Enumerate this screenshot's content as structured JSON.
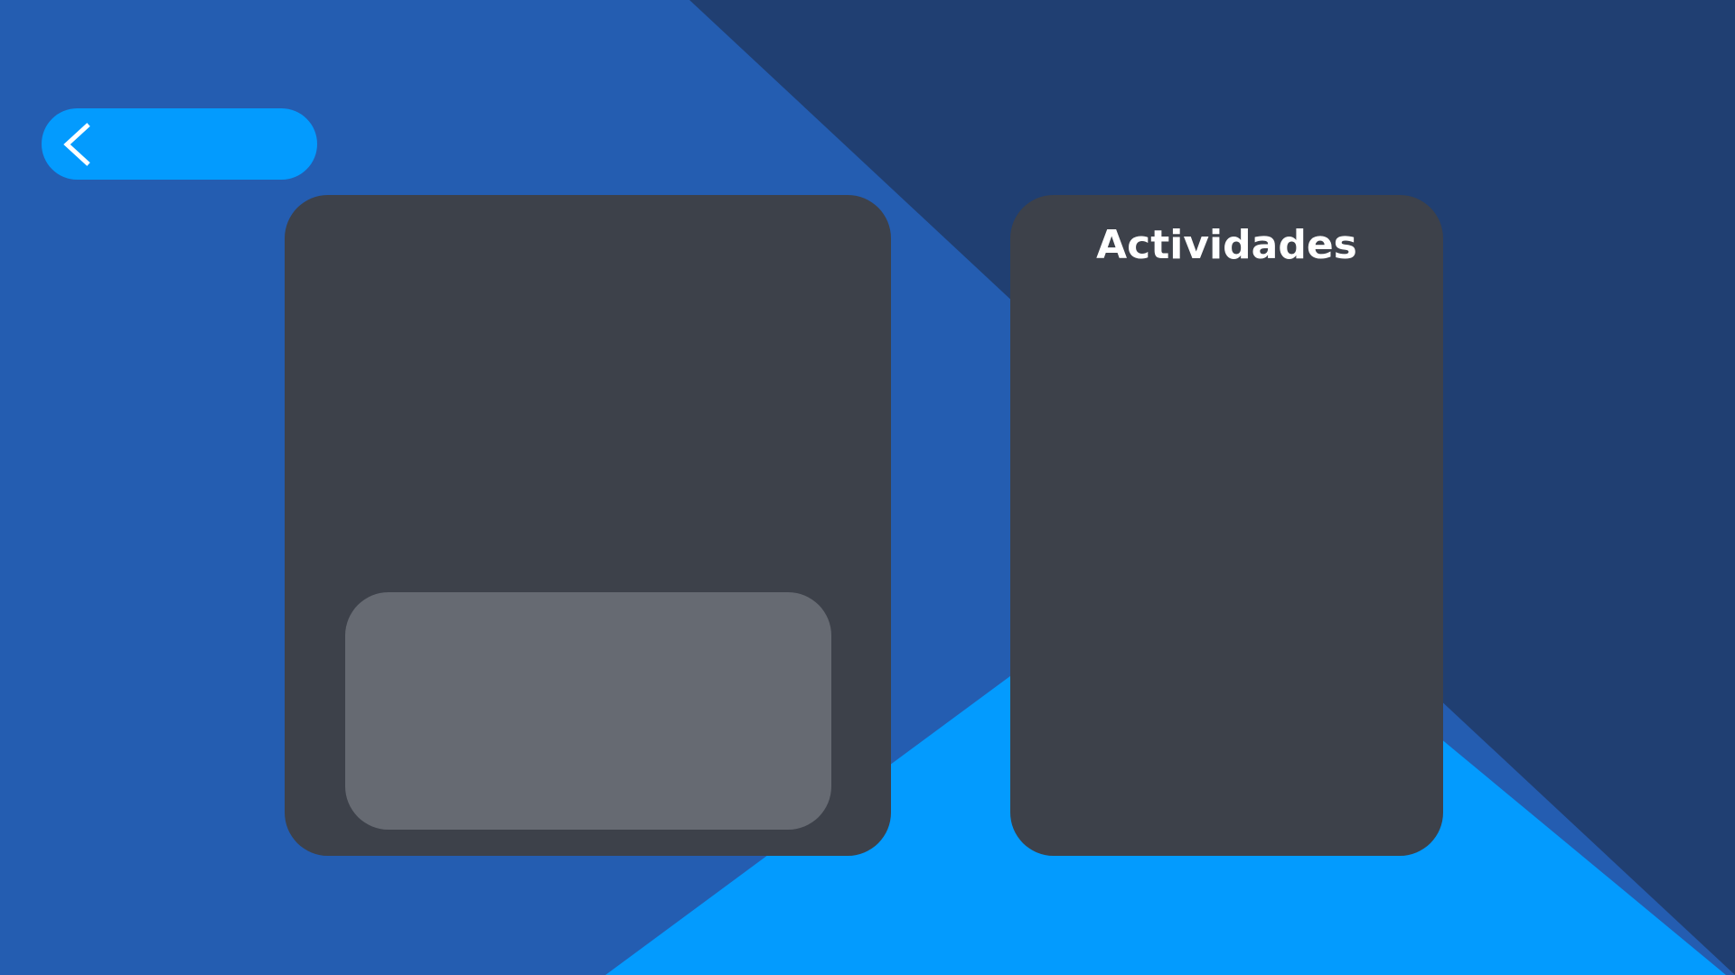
{
  "header": {
    "back_icon": "chevron-left-icon"
  },
  "activities_panel": {
    "title": "Actividades"
  },
  "colors": {
    "background_blue": "#245db1",
    "background_dark": "#203f72",
    "accent": "#039bfe",
    "panel": "#3d414a",
    "card": "#666a72",
    "text": "#ffffff"
  }
}
